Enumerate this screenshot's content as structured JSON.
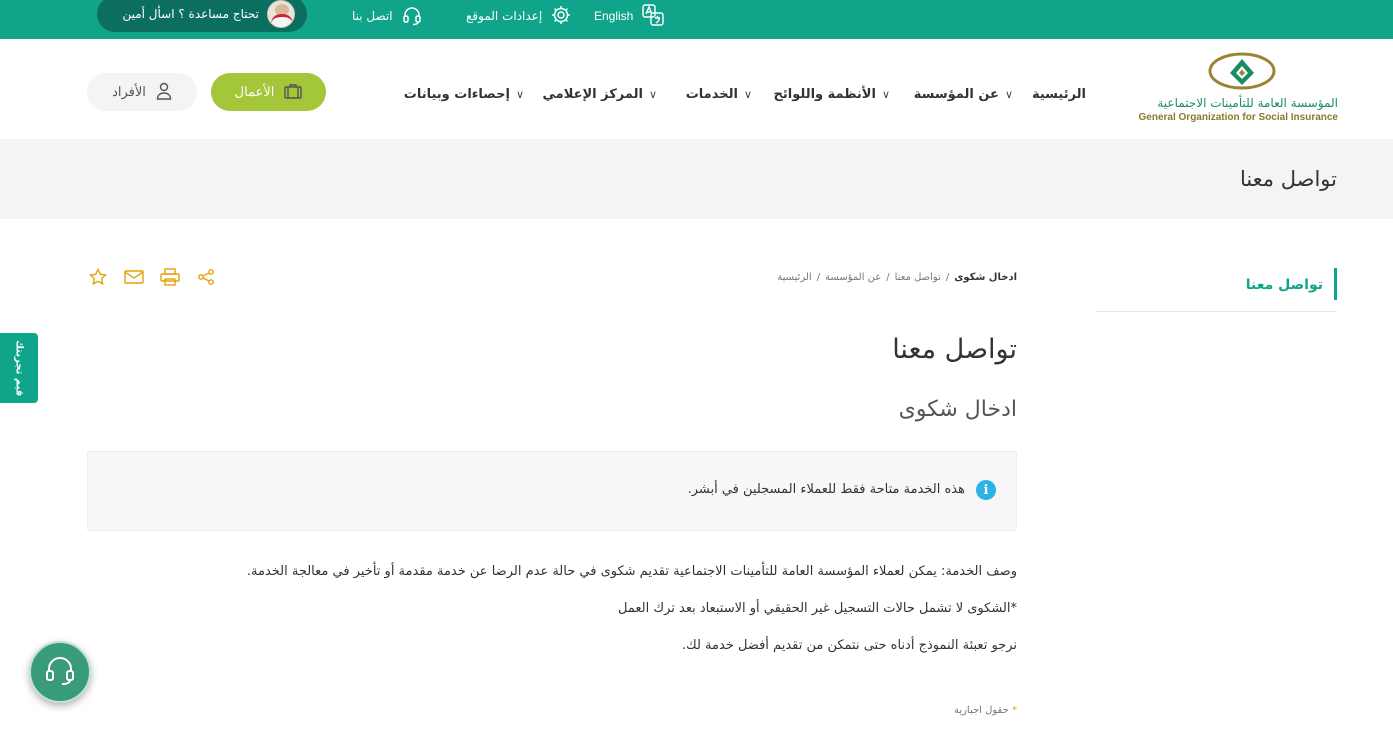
{
  "topbar": {
    "help_text": "تحتاج مساعدة ؟ اسأل أمين",
    "contact_label": "اتصل بنا",
    "settings_label": "إعدادات الموقع",
    "language_label": "English"
  },
  "header": {
    "logo_ar": "المؤسسة العامة للتأمينات الاجتماعية",
    "logo_en": "General Organization for Social Insurance",
    "nav": [
      {
        "label": "الرئيسية",
        "has_menu": false
      },
      {
        "label": "عن المؤسسة",
        "has_menu": true
      },
      {
        "label": "الأنظمة واللوائح",
        "has_menu": true
      },
      {
        "label": "الخدمات",
        "has_menu": true
      },
      {
        "label": "المركز الإعلامي",
        "has_menu": true
      },
      {
        "label": "إحصاءات وبيانات",
        "has_menu": true
      }
    ],
    "business_label": "الأعمال",
    "individuals_label": "الأفراد"
  },
  "band": {
    "title": "تواصل معنا"
  },
  "sidebar": {
    "items": [
      {
        "label": "تواصل معنا",
        "active": true
      }
    ]
  },
  "breadcrumb": [
    "الرئيسية",
    "عن المؤسسة",
    "تواصل معنا",
    "ادخال شكوى"
  ],
  "main": {
    "title": "تواصل معنا",
    "subtitle": "ادخال شكوى",
    "notice": "هذه الخدمة متاحة فقط للعملاء المسجلين في أبشر.",
    "paragraphs": [
      "وصف الخدمة: يمكن لعملاء المؤسسة العامة للتأمينات الاجتماعية تقديم شكوى في حالة عدم الرضا عن خدمة مقدمة أو تأخير في معالجة الخدمة.",
      "*الشكوى لا تشمل حالات التسجيل غير الحقيقي أو الاستبعاد بعد ترك العمل",
      "نرجو تعبئة النموذج أدناه حتى نتمكن من تقديم أفضل خدمة لك."
    ],
    "required_note": "حقول اجبارية",
    "required_star": "*"
  },
  "feedback_tab": "قيم تجربتك",
  "colors": {
    "primary": "#10a58a",
    "accent": "#a4c639",
    "icon": "#e5a10b"
  },
  "icons": [
    "share-icon",
    "print-icon",
    "mail-icon",
    "star-icon",
    "headset-icon",
    "gear-icon",
    "translate-icon",
    "user-icon",
    "briefcase-icon",
    "info-icon"
  ]
}
